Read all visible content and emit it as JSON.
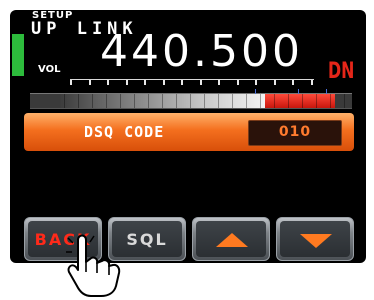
{
  "header": {
    "mode": "SETUP",
    "title": "UP LINK",
    "volume_label": "VOL",
    "frequency": "440.500",
    "direction": "DN"
  },
  "meter": {
    "fill_fraction": 0.67,
    "red_fraction": 0.22
  },
  "dsq": {
    "label": "DSQ CODE",
    "value": "010"
  },
  "softkeys": {
    "back_label": "BACK",
    "sql_label": "SQL",
    "up_icon": "triangle-up-icon",
    "down_icon": "triangle-down-icon"
  },
  "colors": {
    "accent_orange": "#f46f1e",
    "alert_red": "#e52619",
    "status_green": "#2dbb3c"
  }
}
